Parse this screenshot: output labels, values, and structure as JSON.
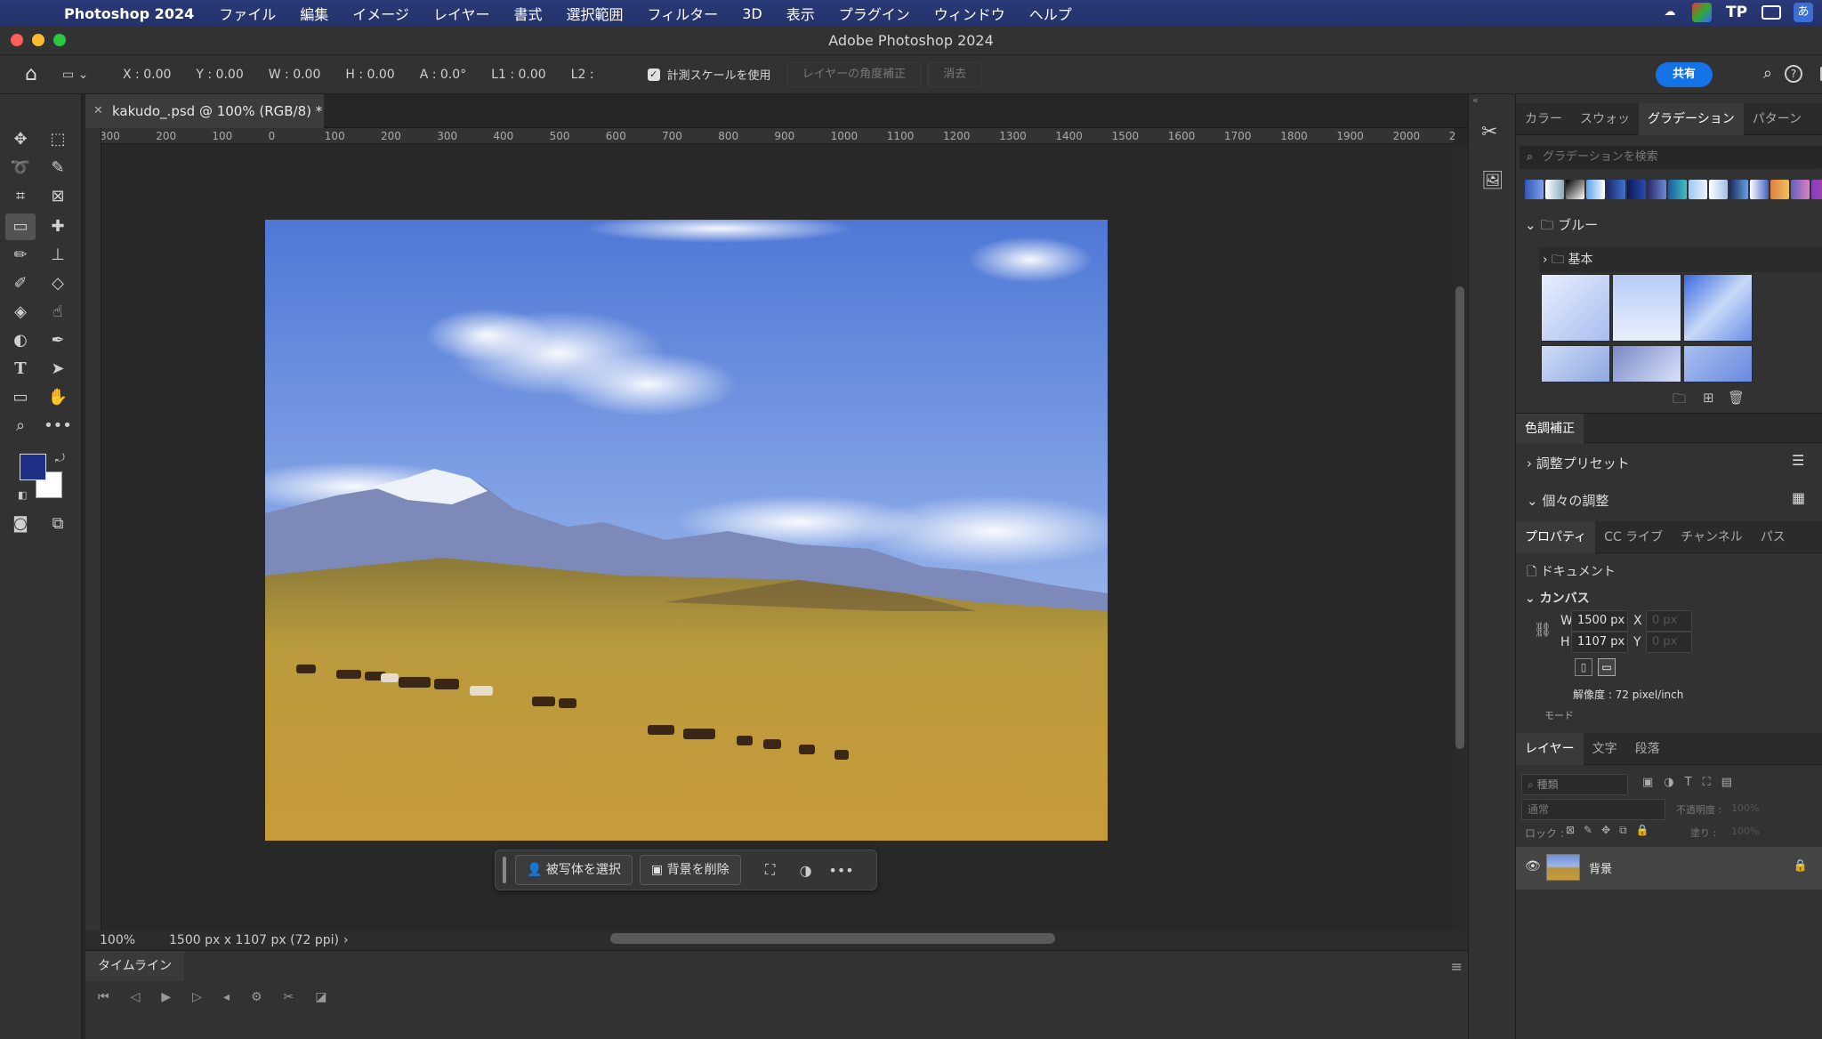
{
  "menubar": {
    "app_name": "Photoshop 2024",
    "items": [
      "ファイル",
      "編集",
      "イメージ",
      "レイヤー",
      "書式",
      "選択範囲",
      "フィルター",
      "3D",
      "表示",
      "プラグイン",
      "ウィンドウ",
      "ヘルプ"
    ],
    "tray_tp": "TP",
    "tray_input": "あ"
  },
  "window": {
    "title": "Adobe Photoshop 2024"
  },
  "options": {
    "x": "X : 0.00",
    "y": "Y : 0.00",
    "w": "W : 0.00",
    "h": "H : 0.00",
    "a": "A : 0.0°",
    "l1": "L1 : 0.00",
    "l2": "L2 :",
    "use_scale": "計測スケールを使用",
    "straighten": "レイヤーの角度補正",
    "clear": "消去",
    "share": "共有"
  },
  "document": {
    "tab_title": "kakudo_.psd @ 100% (RGB/8) *",
    "zoom": "100%",
    "info": "1500 px x 1107 px (72 ppi)",
    "ruler_ticks": [
      "300",
      "200",
      "100",
      "0",
      "100",
      "200",
      "300",
      "400",
      "500",
      "600",
      "700",
      "800",
      "900",
      "1000",
      "1100",
      "1200",
      "1300",
      "1400",
      "1500",
      "1600",
      "1700",
      "1800",
      "1900",
      "2000",
      "2"
    ]
  },
  "contextbar": {
    "select_subject": "被写体を選択",
    "remove_bg": "背景を削除"
  },
  "timeline": {
    "label": "タイムライン"
  },
  "panels": {
    "top_tabs": [
      "カラー",
      "スウォッ",
      "グラデーション",
      "パターン"
    ],
    "gradient_search": "グラデーションを検索",
    "folder_blue": "ブルー",
    "folder_basic": "基本",
    "adjust_title": "色調補正",
    "adjust_presets": "調整プリセット",
    "adjust_individual": "個々の調整",
    "prop_tabs": [
      "プロパティ",
      "CC ライブ",
      "チャンネル",
      "パス"
    ],
    "doc_label": "ドキュメント",
    "canvas_label": "カンバス",
    "w_label": "W",
    "h_label": "H",
    "x_label": "X",
    "y_label": "Y",
    "w_value": "1500 px",
    "h_value": "1107 px",
    "x_placeholder": "0 px",
    "y_placeholder": "0 px",
    "resolution": "解像度 : 72 pixel/inch",
    "mode": "モード",
    "layer_tabs": [
      "レイヤー",
      "文字",
      "段落"
    ],
    "layer_filter": "種類",
    "blend_mode": "通常",
    "opacity_label": "不透明度 :",
    "opacity_value": "100%",
    "lock_label": "ロック :",
    "fill_label": "塗り :",
    "fill_value": "100%",
    "layer_name": "背景"
  },
  "colors": {
    "foreground": "#1f2f86",
    "background": "#ffffff",
    "accent": "#1473e6"
  }
}
